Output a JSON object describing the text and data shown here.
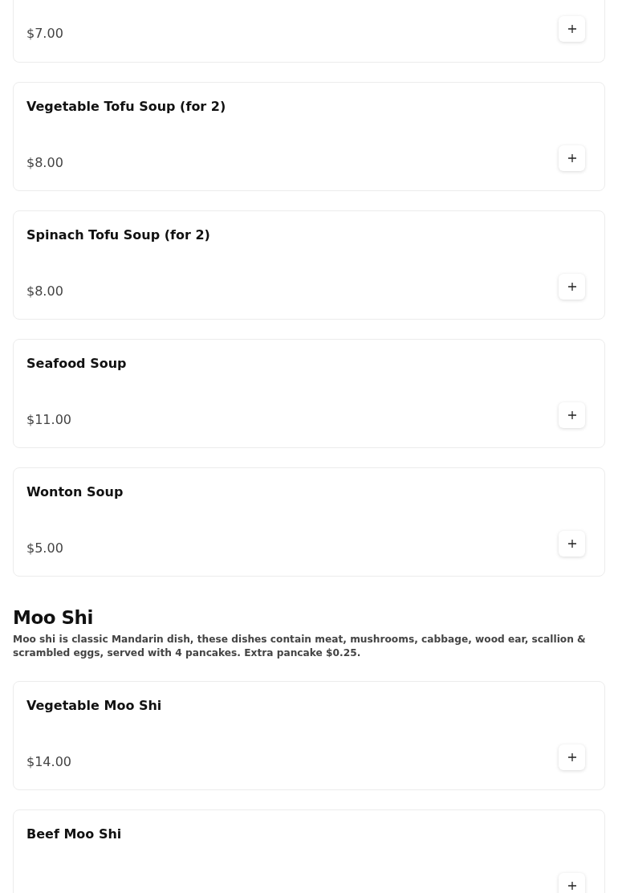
{
  "sections": [
    {
      "items": [
        {
          "price": "$7.00"
        },
        {
          "name": "Vegetable Tofu Soup (for 2)",
          "price": "$8.00"
        },
        {
          "name": "Spinach Tofu Soup (for 2)",
          "price": "$8.00"
        },
        {
          "name": "Seafood Soup",
          "price": "$11.00"
        },
        {
          "name": "Wonton Soup",
          "price": "$5.00"
        }
      ]
    },
    {
      "title": "Moo Shi",
      "description": "Moo shi is classic Mandarin dish, these dishes contain meat, mushrooms, cabbage, wood ear, scallion & scrambled eggs, served with 4 pancakes. Extra pancake $0.25.",
      "items": [
        {
          "name": "Vegetable Moo Shi",
          "price": "$14.00"
        },
        {
          "name": "Beef Moo Shi"
        }
      ]
    }
  ]
}
